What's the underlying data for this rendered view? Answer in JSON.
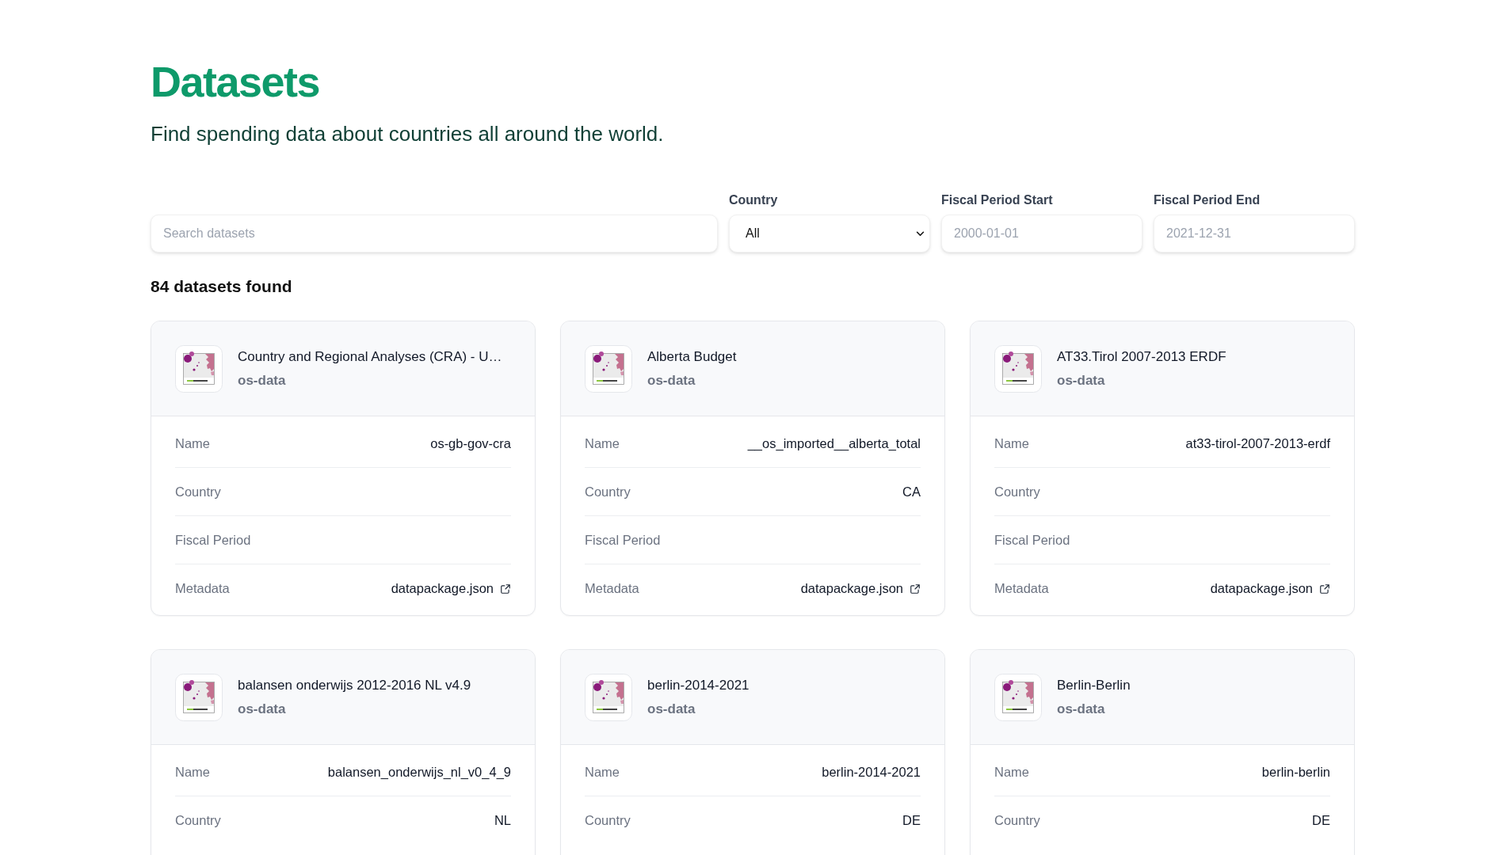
{
  "page": {
    "title": "Datasets",
    "subtitle": "Find spending data about countries all around the world."
  },
  "filters": {
    "search": {
      "placeholder": "Search datasets"
    },
    "country": {
      "label": "Country",
      "value": "All"
    },
    "fiscal_period_start": {
      "label": "Fiscal Period Start",
      "placeholder": "2000-01-01"
    },
    "fiscal_period_end": {
      "label": "Fiscal Period End",
      "placeholder": "2021-12-31"
    }
  },
  "results_count": "84 datasets found",
  "datasets": [
    {
      "title": "Country and Regional Analyses (CRA) - U…",
      "owner": "os-data",
      "fields": [
        {
          "kind": "text",
          "label": "Name",
          "value": "os-gb-gov-cra"
        },
        {
          "kind": "text",
          "label": "Country"
        },
        {
          "kind": "text",
          "label": "Fiscal Period"
        },
        {
          "kind": "link",
          "label": "Metadata",
          "value": "datapackage.json"
        }
      ]
    },
    {
      "title": "Alberta Budget",
      "owner": "os-data",
      "fields": [
        {
          "kind": "text",
          "label": "Name",
          "value": "__os_imported__alberta_total"
        },
        {
          "kind": "text",
          "label": "Country",
          "value": "CA"
        },
        {
          "kind": "text",
          "label": "Fiscal Period"
        },
        {
          "kind": "link",
          "label": "Metadata",
          "value": "datapackage.json"
        }
      ]
    },
    {
      "title": "AT33.Tirol 2007-2013 ERDF",
      "owner": "os-data",
      "fields": [
        {
          "kind": "text",
          "label": "Name",
          "value": "at33-tirol-2007-2013-erdf"
        },
        {
          "kind": "text",
          "label": "Country"
        },
        {
          "kind": "text",
          "label": "Fiscal Period"
        },
        {
          "kind": "link",
          "label": "Metadata",
          "value": "datapackage.json"
        }
      ]
    },
    {
      "title": "balansen onderwijs 2012-2016 NL v4.9",
      "owner": "os-data",
      "fields": [
        {
          "kind": "text",
          "label": "Name",
          "value": "balansen_onderwijs_nl_v0_4_9"
        },
        {
          "kind": "text",
          "label": "Country",
          "value": "NL"
        }
      ]
    },
    {
      "title": "berlin-2014-2021",
      "owner": "os-data",
      "fields": [
        {
          "kind": "text",
          "label": "Name",
          "value": "berlin-2014-2021"
        },
        {
          "kind": "text",
          "label": "Country",
          "value": "DE"
        }
      ]
    },
    {
      "title": "Berlin-Berlin",
      "owner": "os-data",
      "fields": [
        {
          "kind": "text",
          "label": "Name",
          "value": "berlin-berlin"
        },
        {
          "kind": "text",
          "label": "Country",
          "value": "DE"
        }
      ]
    }
  ]
}
